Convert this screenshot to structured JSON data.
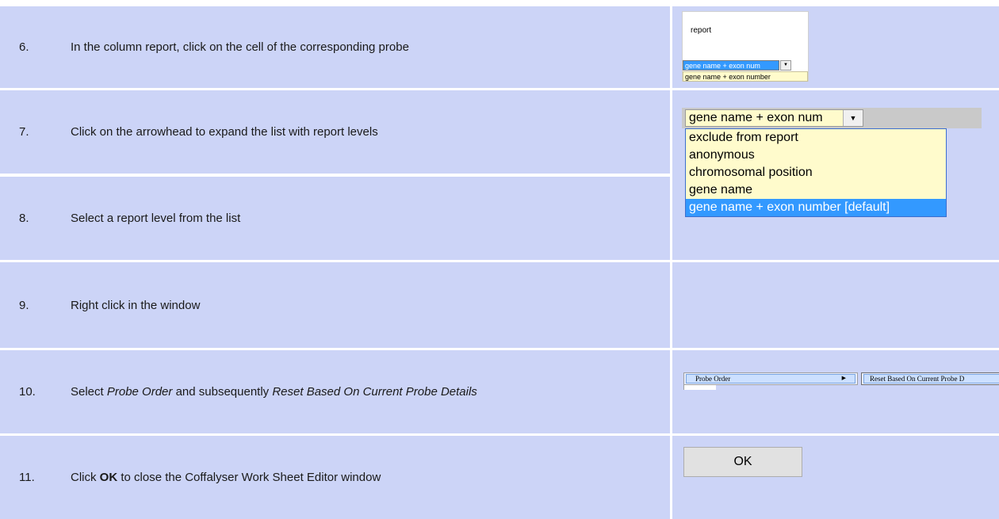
{
  "steps": [
    {
      "num": "6.",
      "text": "In the column report, click on the cell of the corresponding probe"
    },
    {
      "num": "7.",
      "text": "Click on the arrowhead to expand the list with report levels"
    },
    {
      "num": "8.",
      "text": "Select a report level from the list"
    },
    {
      "num": "9.",
      "text": "Right click in the window"
    },
    {
      "num": "10.",
      "text_parts": [
        "Select ",
        "Probe Order",
        " and subsequently ",
        "Reset Based On Current Probe Details"
      ]
    },
    {
      "num": "11.",
      "text_parts": [
        "Click ",
        "OK",
        " to close the Coffalyser Work Sheet Editor window"
      ]
    }
  ],
  "img6": {
    "header": "report",
    "combo_value": "gene name + exon num",
    "dropdown_option": "gene name + exon number"
  },
  "img78": {
    "combo_value": "gene name + exon num",
    "options": [
      "exclude from report",
      "anonymous",
      "chromosomal position",
      "gene name",
      "gene name + exon number [default]"
    ]
  },
  "img10": {
    "menu_item": "Probe Order",
    "submenu_item": "Reset Based On Current Probe D"
  },
  "img11": {
    "button_label": "OK"
  },
  "colors": {
    "cell_background": "#ccd4f7",
    "selection": "#3399ff",
    "dropdown_background": "#fffbcc"
  }
}
